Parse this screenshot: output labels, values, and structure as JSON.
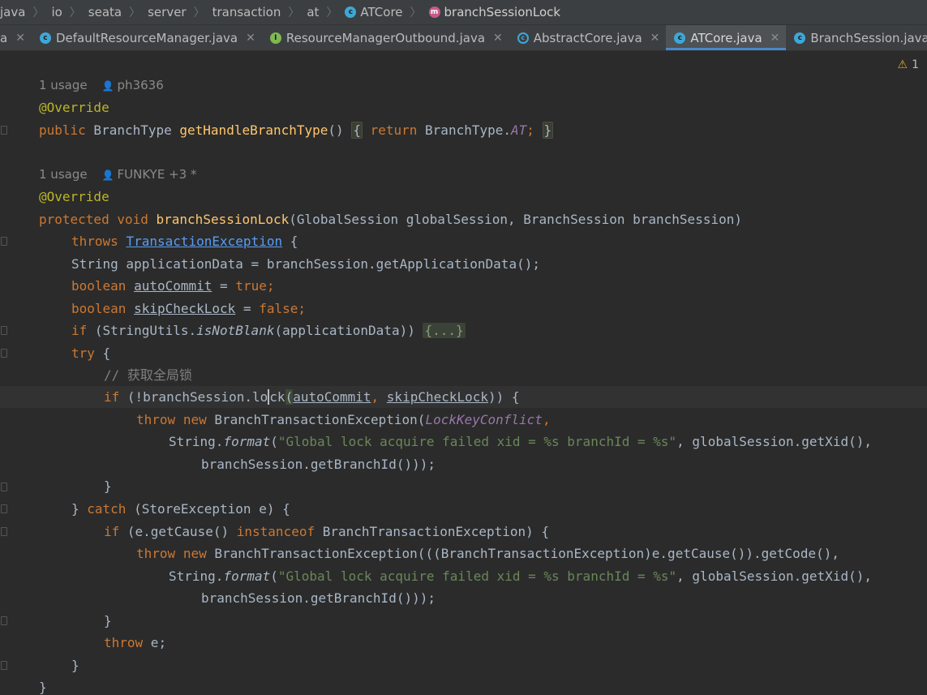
{
  "breadcrumb": [
    {
      "label": "java"
    },
    {
      "label": "io"
    },
    {
      "label": "seata"
    },
    {
      "label": "server"
    },
    {
      "label": "transaction"
    },
    {
      "label": "at"
    },
    {
      "label": "ATCore",
      "icon": "class"
    },
    {
      "label": "branchSessionLock",
      "icon": "method"
    }
  ],
  "tabs": [
    {
      "label": "a",
      "icon": "none",
      "active": false
    },
    {
      "label": "DefaultResourceManager.java",
      "icon": "class",
      "active": false
    },
    {
      "label": "ResourceManagerOutbound.java",
      "icon": "iface",
      "active": false
    },
    {
      "label": "AbstractCore.java",
      "icon": "abstract",
      "active": false
    },
    {
      "label": "ATCore.java",
      "icon": "class",
      "active": true
    },
    {
      "label": "BranchSession.java",
      "icon": "class",
      "active": false
    }
  ],
  "warning": {
    "count": "1"
  },
  "hints": {
    "h1_usage": "1 usage",
    "h1_author": "ph3636",
    "h2_usage": "1 usage",
    "h2_author": "FUNKYE +3 *"
  },
  "code": {
    "l1_ann": "@Override",
    "l2_kw": "public",
    "l2_type": " BranchType ",
    "l2_fn": "getHandleBranchType",
    "l2_paren": "()",
    "l2_brace_open": "{",
    "l2_ret": "return",
    "l2_type2": " BranchType.",
    "l2_const": "AT",
    "l2_semi": ";",
    "l2_brace_close": "}",
    "l3_ann": "@Override",
    "l4_kw1": "protected",
    "l4_kw2": "void",
    "l4_fn": "branchSessionLock",
    "l4_params": "(GlobalSession globalSession, BranchSession branchSession)",
    "l5_kw": "throws",
    "l5_exc": "TransactionException",
    "l5_rest": " {",
    "l6_text": "String applicationData = branchSession.getApplicationData();",
    "l7_kw": "boolean",
    "l7_var": "autoCommit",
    "l7_eq": " = ",
    "l7_val": "true",
    "l7_semi": ";",
    "l8_kw": "boolean",
    "l8_var": "skipCheckLock",
    "l8_eq": " = ",
    "l8_val": "false",
    "l8_semi": ";",
    "l9_kw": "if",
    "l9_pre": " (StringUtils.",
    "l9_method": "isNotBlank",
    "l9_post": "(applicationData)) ",
    "l9_folded": "{...}",
    "l10_kw": "try",
    "l10_rest": " {",
    "l11_cmt": "// 获取全局锁",
    "l12_kw": "if",
    "l12_pre": " (!branchSession.",
    "l12_lo": "lo",
    "l12_ck": "ck",
    "l12_paren_open": "(",
    "l12_arg1": "autoCommit",
    "l12_comma": ", ",
    "l12_arg2": "skipCheckLock",
    "l12_post": ")) {",
    "l13_kw1": "throw",
    "l13_kw2": "new",
    "l13_cls": " BranchTransactionException(",
    "l13_const": "LockKeyConflict",
    "l13_comma": ",",
    "l14_pre": "String.",
    "l14_method": "format",
    "l14_paren": "(",
    "l14_str": "\"Global lock acquire failed xid = %s branchId = %s\"",
    "l14_post": ", globalSession.getXid(),",
    "l15_text": "branchSession.getBranchId()));",
    "l16_text": "}",
    "l17_brace": "} ",
    "l17_kw": "catch",
    "l17_rest": " (StoreException e) {",
    "l18_kw1": "if",
    "l18_mid": " (e.getCause() ",
    "l18_kw2": "instanceof",
    "l18_rest": " BranchTransactionException) {",
    "l19_kw1": "throw",
    "l19_kw2": "new",
    "l19_rest": " BranchTransactionException(((BranchTransactionException)e.getCause()).getCode(),",
    "l20_pre": "String.",
    "l20_method": "format",
    "l20_paren": "(",
    "l20_str": "\"Global lock acquire failed xid = %s branchId = %s\"",
    "l20_post": ", globalSession.getXid(),",
    "l21_text": "branchSession.getBranchId()));",
    "l22_text": "}",
    "l23_kw": "throw",
    "l23_rest": " e;",
    "l24_text": "}",
    "l25_text": "}"
  }
}
